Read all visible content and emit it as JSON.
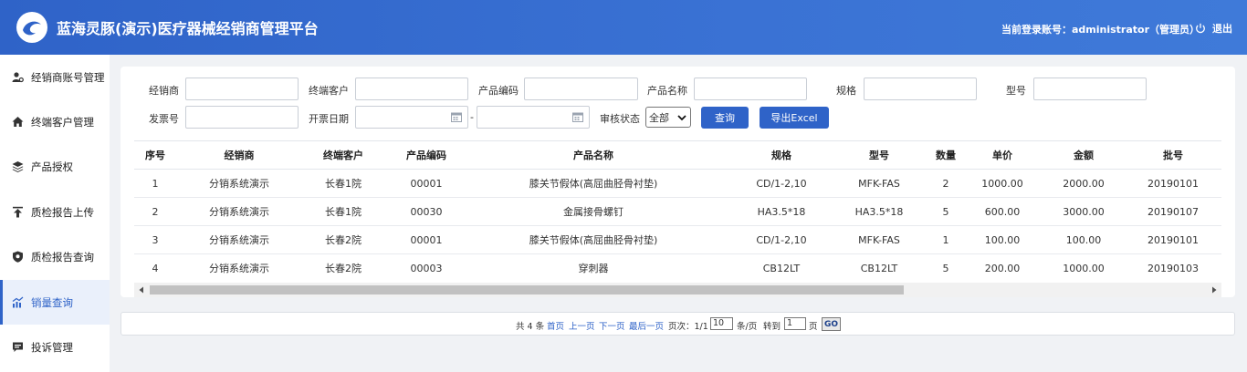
{
  "header": {
    "app_title": "蓝海灵豚(演示)医疗器械经销商管理平台",
    "login_info": "当前登录账号：administrator（管理员）",
    "logout_label": "退出"
  },
  "sidebar": {
    "items": [
      {
        "label": "经销商账号管理",
        "icon": "user-gear-icon"
      },
      {
        "label": "终端客户管理",
        "icon": "home-icon"
      },
      {
        "label": "产品授权",
        "icon": "layers-icon"
      },
      {
        "label": "质检报告上传",
        "icon": "upload-icon"
      },
      {
        "label": "质检报告查询",
        "icon": "shield-icon"
      },
      {
        "label": "销量查询",
        "icon": "chart-icon",
        "active": true
      },
      {
        "label": "投诉管理",
        "icon": "message-icon"
      }
    ]
  },
  "filters": {
    "dealer_label": "经销商",
    "terminal_label": "终端客户",
    "product_code_label": "产品编码",
    "product_name_label": "产品名称",
    "spec_label": "规格",
    "model_label": "型号",
    "invoice_label": "发票号",
    "invoice_date_label": "开票日期",
    "date_separator": "-",
    "review_label": "审核状态",
    "review_value": "全部",
    "query_button": "查询",
    "export_button": "导出Excel"
  },
  "table": {
    "columns": [
      "序号",
      "经销商",
      "终端客户",
      "产品编码",
      "产品名称",
      "规格",
      "型号",
      "数量",
      "单价",
      "金额",
      "批号"
    ],
    "rows": [
      [
        "1",
        "分销系统演示",
        "长春1院",
        "00001",
        "膝关节假体(高屈曲胫骨衬垫)",
        "CD/1-2,10",
        "MFK-FAS",
        "2",
        "1000.00",
        "2000.00",
        "20190101"
      ],
      [
        "2",
        "分销系统演示",
        "长春1院",
        "00030",
        "金属接骨螺钉",
        "HA3.5*18",
        "HA3.5*18",
        "5",
        "600.00",
        "3000.00",
        "20190107"
      ],
      [
        "3",
        "分销系统演示",
        "长春2院",
        "00001",
        "膝关节假体(高屈曲胫骨衬垫)",
        "CD/1-2,10",
        "MFK-FAS",
        "1",
        "100.00",
        "100.00",
        "20190101"
      ],
      [
        "4",
        "分销系统演示",
        "长春2院",
        "00003",
        "穿刺器",
        "CB12LT",
        "CB12LT",
        "5",
        "200.00",
        "1000.00",
        "20190103"
      ]
    ]
  },
  "pager": {
    "total": "共 4 条",
    "first": "首页",
    "prev": "上一页",
    "next": "下一页",
    "last": "最后一页",
    "page_info": "页次：1/1",
    "page_size": "10",
    "per_page": "条/页",
    "goto": "转到",
    "goto_value": "1",
    "page_unit": "页",
    "go": "GO"
  },
  "colors": {
    "brand": "#2f63c8",
    "active_bg": "#eaf0fb"
  }
}
